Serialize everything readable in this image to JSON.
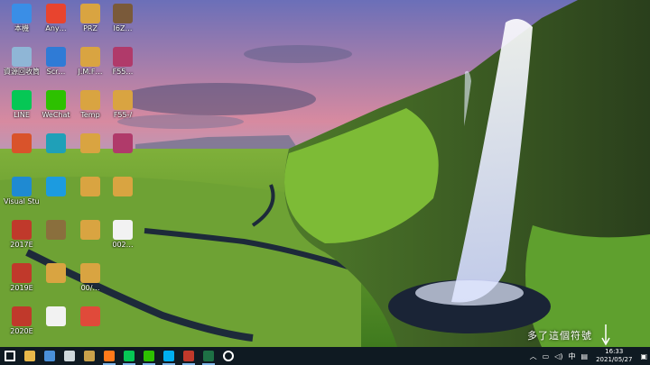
{
  "desktop": {
    "icons": [
      {
        "label": "本機",
        "icon": "computer-icon",
        "color": "#3a8ee6"
      },
      {
        "label": "Any…",
        "icon": "anydesk-icon",
        "color": "#e8442e"
      },
      {
        "label": "PRZ",
        "icon": "folder-icon",
        "color": "#d9a441"
      },
      {
        "label": "I6Z…",
        "icon": "image-file-icon",
        "color": "#7a5a3a"
      },
      {
        "label": "資源回收筒",
        "icon": "recycle-bin-icon",
        "color": "#8fb6d6"
      },
      {
        "label": "Scr…",
        "icon": "screenshot-icon",
        "color": "#2f7bd6"
      },
      {
        "label": "J.M.F…",
        "icon": "folder-icon",
        "color": "#d9a441"
      },
      {
        "label": "F55…",
        "icon": "archive-icon",
        "color": "#b03a6a"
      },
      {
        "label": "LINE",
        "icon": "line-icon",
        "color": "#06c755"
      },
      {
        "label": "WeChat",
        "icon": "wechat-icon",
        "color": "#2dc100"
      },
      {
        "label": "Temp",
        "icon": "folder-icon",
        "color": "#d9a441"
      },
      {
        "label": "F55-/",
        "icon": "folder-icon",
        "color": "#d9a441"
      },
      {
        "label": "",
        "icon": "office-icon",
        "color": "#d9532b"
      },
      {
        "label": "",
        "icon": "app-icon",
        "color": "#1fa0b8"
      },
      {
        "label": "",
        "icon": "folder-icon",
        "color": "#d9a441"
      },
      {
        "label": "",
        "icon": "archive-icon",
        "color": "#b03a6a"
      },
      {
        "label": "Visual Stu…",
        "icon": "vscode-icon",
        "color": "#1f8ad2"
      },
      {
        "label": "",
        "icon": "app-icon",
        "color": "#1c9be0"
      },
      {
        "label": "",
        "icon": "folder-icon",
        "color": "#d9a441"
      },
      {
        "label": "",
        "icon": "folder-icon",
        "color": "#d9a441"
      },
      {
        "label": "2017E",
        "icon": "app-icon",
        "color": "#c0392b"
      },
      {
        "label": "",
        "icon": "app-icon",
        "color": "#8a6f3d"
      },
      {
        "label": "",
        "icon": "folder-icon",
        "color": "#d9a441"
      },
      {
        "label": "002…",
        "icon": "document-icon",
        "color": "#f2f2f2"
      },
      {
        "label": "2019E",
        "icon": "app-icon",
        "color": "#c0392b"
      },
      {
        "label": "",
        "icon": "folder-icon",
        "color": "#d9a441"
      },
      {
        "label": "00/…",
        "icon": "folder-icon",
        "color": "#d9a441"
      },
      {
        "label": "",
        "icon": "blank-icon",
        "color": "#00000000"
      },
      {
        "label": "2020E",
        "icon": "app-icon",
        "color": "#c0392b"
      },
      {
        "label": "",
        "icon": "document-icon",
        "color": "#f2f2f2"
      },
      {
        "label": "",
        "icon": "pdf-icon",
        "color": "#e04a3a"
      },
      {
        "label": "",
        "icon": "blank-icon",
        "color": "#00000000"
      }
    ]
  },
  "annotation": {
    "text": "多了這個符號"
  },
  "taskbar": {
    "buttons": [
      {
        "name": "start-button",
        "icon": "windows-icon",
        "color": "#ffffff"
      },
      {
        "name": "file-explorer-button",
        "icon": "folder-icon",
        "color": "#e8b84a"
      },
      {
        "name": "app-button",
        "icon": "app-icon",
        "color": "#4a90d9"
      },
      {
        "name": "edge-button",
        "icon": "browser-icon",
        "color": "#cfd8dc"
      },
      {
        "name": "photos-button",
        "icon": "photos-icon",
        "color": "#c9a14a"
      },
      {
        "name": "firefox-button",
        "icon": "firefox-icon",
        "color": "#ff7a1a"
      },
      {
        "name": "line-button",
        "icon": "line-icon",
        "color": "#06c755"
      },
      {
        "name": "wechat-button",
        "icon": "wechat-icon",
        "color": "#2dc100"
      },
      {
        "name": "skype-button",
        "icon": "skype-icon",
        "color": "#00aff0"
      },
      {
        "name": "app2-button",
        "icon": "app-icon",
        "color": "#c0392b"
      },
      {
        "name": "excel-button",
        "icon": "excel-icon",
        "color": "#1e7145"
      },
      {
        "name": "settings-button",
        "icon": "gear-icon",
        "color": "#ffffff"
      }
    ],
    "tray": {
      "ime": "中",
      "time": "16:33",
      "date": "2021/05/27"
    }
  }
}
